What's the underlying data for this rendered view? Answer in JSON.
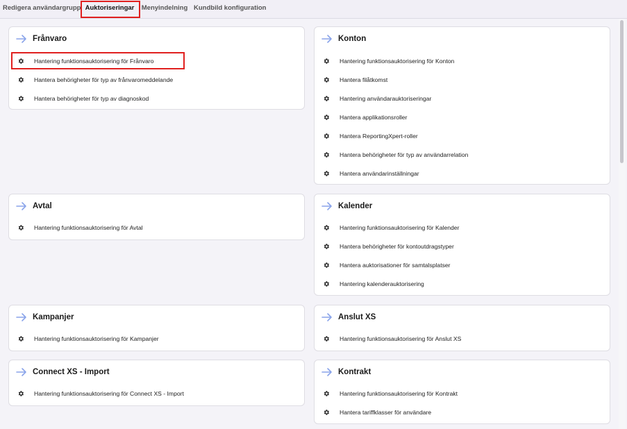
{
  "tabs": [
    "Redigera användargrupp",
    "Auktoriseringar",
    "Menyindelning",
    "Kundbild konfiguration"
  ],
  "active_tab": "Auktoriseringar",
  "accent_color": "#6b4fd6",
  "highlight_color": "#e0201f",
  "icons": {
    "card_header": "arrow-right-icon",
    "item": "gear-icon"
  },
  "cards": {
    "franvaro": {
      "title": "Frånvaro",
      "items": [
        "Hantering funktionsauktorisering för Frånvaro",
        "Hantera behörigheter för typ av frånvaromeddelande",
        "Hantera behörigheter för typ av diagnoskod"
      ]
    },
    "konton": {
      "title": "Konton",
      "items": [
        "Hantering funktionsauktorisering för Konton",
        "Hantera filåtkomst",
        "Hantering användarauktoriseringar",
        "Hantera applikationsroller",
        "Hantera ReportingXpert-roller",
        "Hantera behörigheter för typ av användarrelation",
        "Hantera användarinställningar"
      ]
    },
    "avtal": {
      "title": "Avtal",
      "items": [
        "Hantering funktionsauktorisering för Avtal"
      ]
    },
    "kalender": {
      "title": "Kalender",
      "items": [
        "Hantering funktionsauktorisering för Kalender",
        "Hantera behörigheter för kontoutdragstyper",
        "Hantera auktorisationer för samtalsplatser",
        "Hantering kalenderauktorisering"
      ]
    },
    "kampanjer": {
      "title": "Kampanjer",
      "items": [
        "Hantering funktionsauktorisering för Kampanjer"
      ]
    },
    "anslut_xs": {
      "title": "Anslut XS",
      "items": [
        "Hantering funktionsauktorisering för Anslut XS"
      ]
    },
    "connect_xs": {
      "title": "Connect XS - Import",
      "items": [
        "Hantering funktionsauktorisering för Connect XS - Import"
      ]
    },
    "kontrakt": {
      "title": "Kontrakt",
      "items": [
        "Hantering funktionsauktorisering för Kontrakt",
        "Hantera tariffklasser för användare"
      ]
    }
  }
}
